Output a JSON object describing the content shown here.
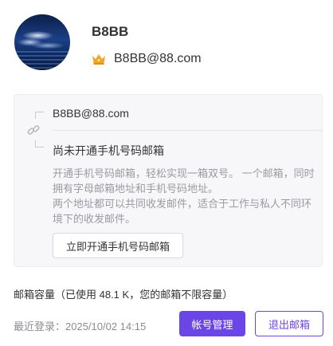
{
  "profile": {
    "username": "B8BB",
    "email": "B8BB@88.com",
    "vip_icon": "crown-icon"
  },
  "mailbox_card": {
    "email": "B8BB@88.com",
    "link_icon": "link-icon",
    "status": "尚未开通手机号码邮箱",
    "description_1": "开通手机号码邮箱，轻松实现一箱双号。 一个邮箱，同时拥有字母邮箱地址和手机号码地址。",
    "description_2": "两个地址都可以共同收发邮件，适合于工作与私人不同环境下的收发邮件。",
    "open_button": "立即开通手机号码邮箱"
  },
  "footer": {
    "capacity": "邮箱容量（已使用 48.1 K，您的邮箱不限容量）",
    "last_login": "最近登录：2025/10/02 14:15",
    "account_button": "帐号管理",
    "logout_button": "退出邮箱"
  },
  "colors": {
    "accent": "#6b46e6",
    "crown": "#f2a623"
  }
}
